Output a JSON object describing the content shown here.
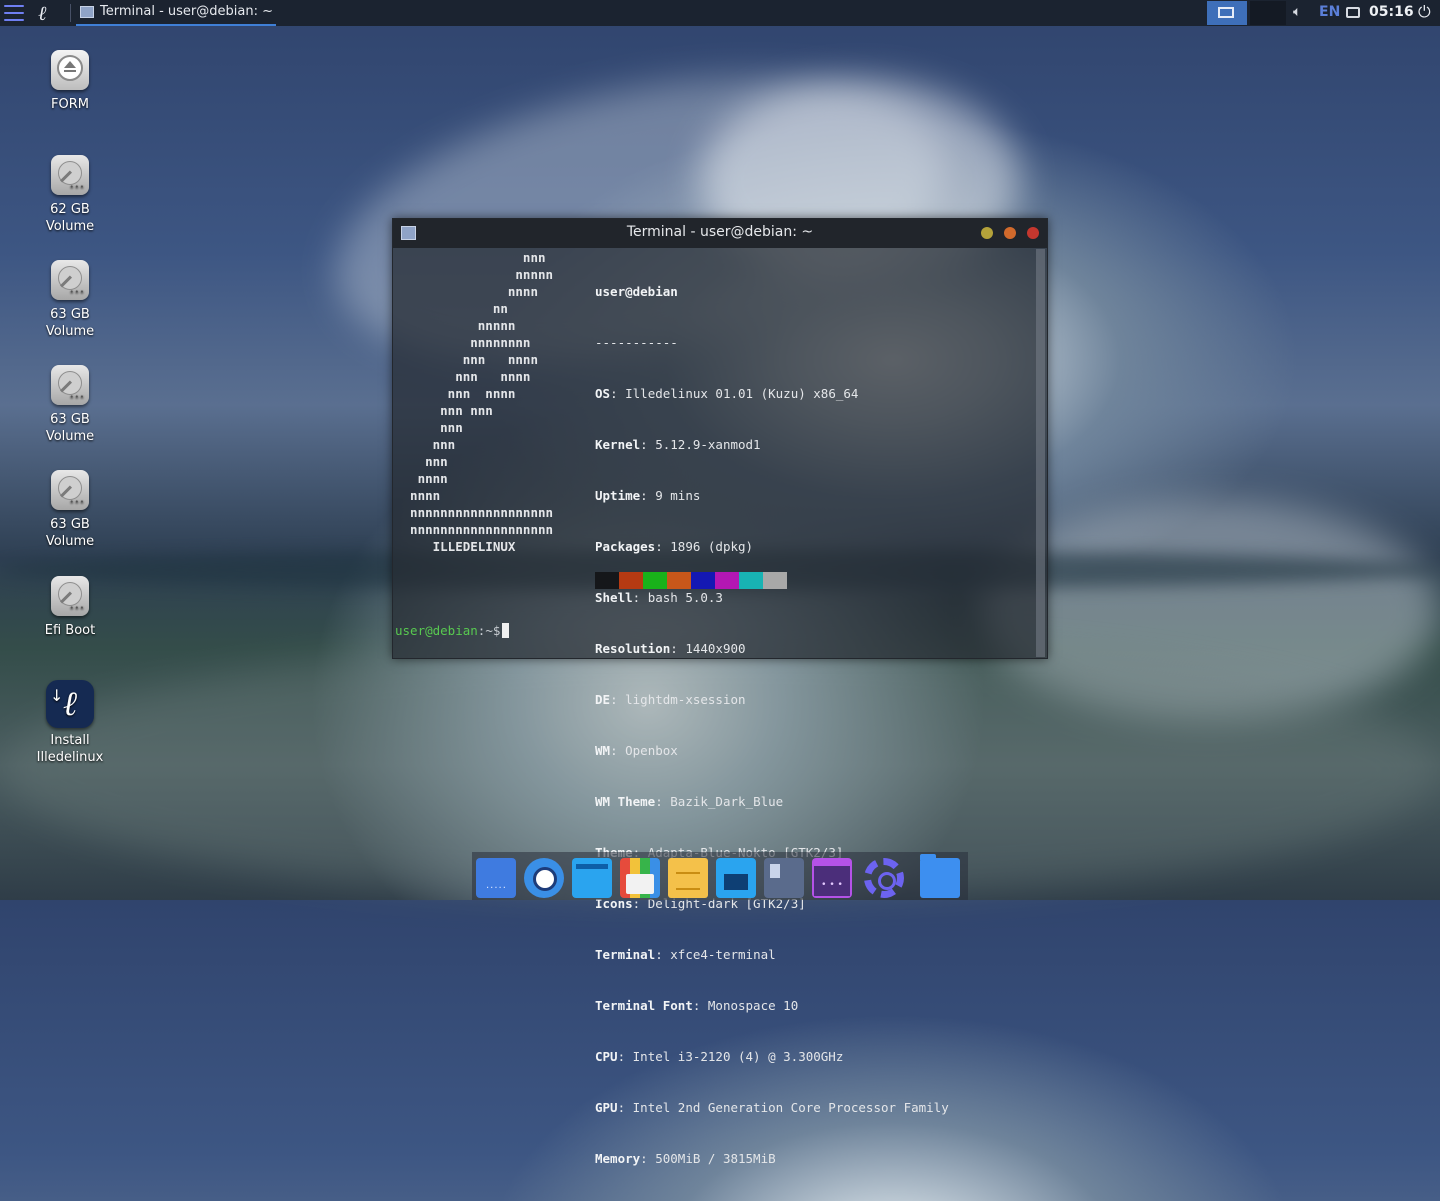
{
  "panel": {
    "task_label": "Terminal - user@debian: ~",
    "language": "EN",
    "clock": "05:16"
  },
  "desktop_icons": [
    {
      "label": "FORM"
    },
    {
      "label": "62 GB\nVolume"
    },
    {
      "label": "63 GB\nVolume"
    },
    {
      "label": "63 GB\nVolume"
    },
    {
      "label": "63 GB\nVolume"
    },
    {
      "label": "Efi Boot"
    },
    {
      "label": "Install\nIlledelinux"
    }
  ],
  "terminal": {
    "title": "Terminal - user@debian: ~",
    "ascii_art": "                 nnn\n                nnnnn\n               nnnn\n             nn\n           nnnnn\n          nnnnnnnn\n         nnn   nnnn\n        nnn   nnnn\n       nnn  nnnn\n      nnn nnn\n      nnn\n     nnn\n    nnn\n   nnnn\n  nnnn\n  nnnnnnnnnnnnnnnnnnn\n  nnnnnnnnnnnnnnnnnnn\n     ILLEDELINUX",
    "header": "user@debian",
    "divider": "-----------",
    "info": [
      {
        "key": "OS",
        "value": "Illedelinux 01.01 (Kuzu) x86_64"
      },
      {
        "key": "Kernel",
        "value": "5.12.9-xanmod1"
      },
      {
        "key": "Uptime",
        "value": "9 mins"
      },
      {
        "key": "Packages",
        "value": "1896 (dpkg)"
      },
      {
        "key": "Shell",
        "value": "bash 5.0.3"
      },
      {
        "key": "Resolution",
        "value": "1440x900"
      },
      {
        "key": "DE",
        "value": "lightdm-xsession"
      },
      {
        "key": "WM",
        "value": "Openbox"
      },
      {
        "key": "WM Theme",
        "value": "Bazik_Dark_Blue"
      },
      {
        "key": "Theme",
        "value": "Adapta-Blue-Nokto [GTK2/3]"
      },
      {
        "key": "Icons",
        "value": "Delight-dark [GTK2/3]"
      },
      {
        "key": "Terminal",
        "value": "xfce4-terminal"
      },
      {
        "key": "Terminal Font",
        "value": "Monospace 10"
      },
      {
        "key": "CPU",
        "value": "Intel i3-2120 (4) @ 3.300GHz"
      },
      {
        "key": "GPU",
        "value": "Intel 2nd Generation Core Processor Family"
      },
      {
        "key": "Memory",
        "value": "500MiB / 3815MiB"
      }
    ],
    "palette": [
      "#15171a",
      "#b63a12",
      "#19b21a",
      "#c7571a",
      "#1418b3",
      "#b317b3",
      "#18b3b3",
      "#a8a8a8"
    ],
    "prompt_user": "user@debian",
    "prompt_rest": ":~$"
  },
  "dock": {
    "items": [
      "show-desktop-icon",
      "browser-icon",
      "file-manager-icon",
      "app-store-icon",
      "notes-icon",
      "save-icon",
      "terminal-icon",
      "panel-icon",
      "settings-icon",
      "folder-icon"
    ]
  }
}
